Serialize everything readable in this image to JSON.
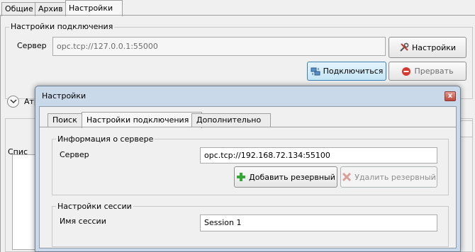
{
  "main_tabs": [
    {
      "label": "Общие"
    },
    {
      "label": "Архив"
    },
    {
      "label": "Настройки"
    }
  ],
  "connection_group": {
    "title": "Настройки подключения",
    "server_label": "Сервер",
    "server_value": "opc.tcp://127.0.0.1:55000",
    "settings_button": "Настройки",
    "connect_button": "Подключиться",
    "abort_button": "Прервать"
  },
  "partial_labels": {
    "attributes_expander": "Атр",
    "list_label": "Спис"
  },
  "dialog": {
    "title": "Настройки",
    "close_glyph": "x",
    "tabs": [
      {
        "label": "Поиск"
      },
      {
        "label": "Настройки подключения"
      },
      {
        "label": "Дополнительно"
      }
    ],
    "server_info": {
      "title": "Информация о сервере",
      "server_label": "Сервер",
      "server_value": "opc.tcp://192.168.72.134:55100",
      "add_backup_button": "Добавить резервный",
      "remove_backup_button": "Удалить резервный"
    },
    "session": {
      "title": "Настройки сессии",
      "session_name_label": "Имя сессии",
      "session_name_value": "Session 1"
    }
  },
  "icons": {
    "settings": "tools-icon",
    "connect": "network-icon",
    "abort": "stop-icon",
    "add": "plus-icon",
    "remove": "x-icon"
  },
  "colors": {
    "accent_blue": "#3c7fb1",
    "stop_red": "#d43a2f",
    "add_green": "#3aa63a"
  }
}
